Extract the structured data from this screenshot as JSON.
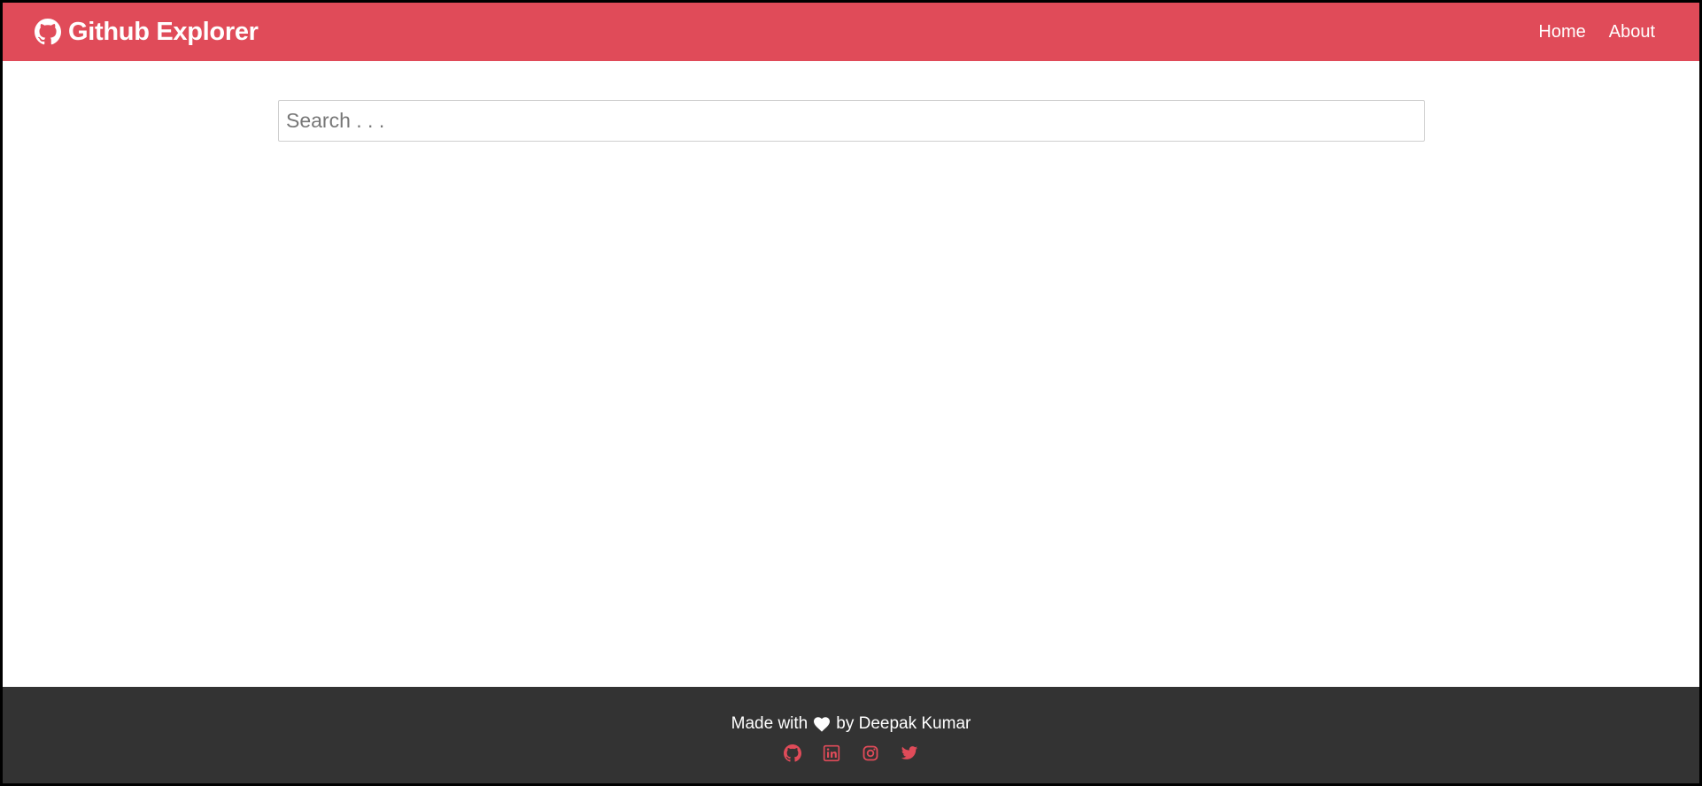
{
  "header": {
    "brand_title": "Github Explorer",
    "brand_icon": "github-icon",
    "nav": [
      {
        "label": "Home"
      },
      {
        "label": "About"
      }
    ]
  },
  "search": {
    "placeholder": "Search . . .",
    "value": ""
  },
  "footer": {
    "made_with": "Made with",
    "heart_icon": "heart-icon",
    "by_text": "by Deepak Kumar",
    "social_icons": [
      "github-icon",
      "linkedin-icon",
      "instagram-icon",
      "twitter-icon"
    ]
  },
  "colors": {
    "navbar_bg": "#e04b59",
    "footer_bg": "#333333",
    "social_icon": "#e04b59",
    "text_light": "#ffffff"
  }
}
